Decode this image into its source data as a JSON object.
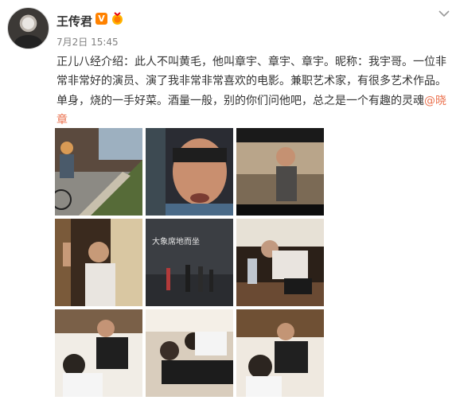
{
  "header": {
    "username": "王传君",
    "verified_badge": "V",
    "badge_icon": "medal-icon",
    "timestamp": "7月2日 15:45"
  },
  "post": {
    "text": "正儿八经介绍：此人不叫黄毛，他叫章宇、章宇、章宇。昵称：我宇哥。一位非常非常好的演员、演了我非常非常喜欢的电影。兼职艺术家，有很多艺术作品。单身，烧的一手好菜。酒量一般，别的你们问他吧，总之是一个有趣的灵魂",
    "mention": "@晓章"
  },
  "photo_grid": {
    "count": 9,
    "poster_title": "大象席地而坐"
  },
  "colors": {
    "brand": "#ff8200",
    "link": "#eb7350",
    "text": "#333333",
    "meta": "#808080"
  }
}
